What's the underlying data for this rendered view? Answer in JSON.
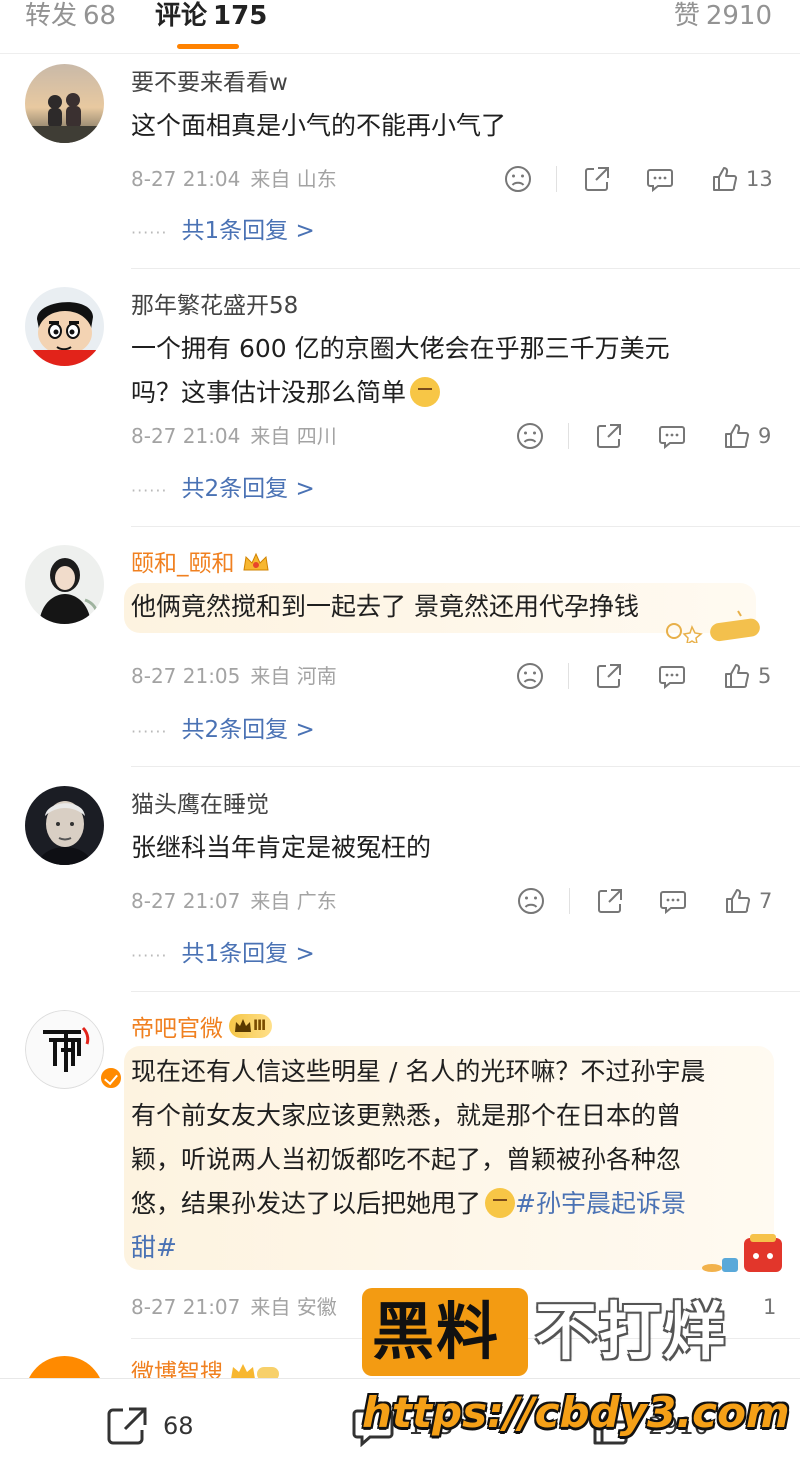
{
  "tabs": {
    "repost": {
      "label": "转发",
      "count": "68"
    },
    "comment": {
      "label": "评论",
      "count": "175"
    },
    "like": {
      "label": "赞",
      "count": "2910"
    }
  },
  "colors": {
    "accent": "#ff8200",
    "link": "#4a72b4",
    "badge_name": "#f08020"
  },
  "comments": [
    {
      "username": "要不要来看看w",
      "text": [
        "这个面相真是小气的不能再小气了"
      ],
      "date": "8-27 21:04",
      "from": "来自 山东",
      "likes": "13",
      "replies": "共1条回复 >"
    },
    {
      "username": "那年繁花盛开58",
      "text": [
        "一个拥有 600 亿的京圈大佬会在乎那三千万美元",
        "吗？这事估计没那么简单"
      ],
      "date": "8-27 21:04",
      "from": "来自 四川",
      "likes": "9",
      "replies": "共2条回复 >"
    },
    {
      "username": "颐和_颐和",
      "text": [
        "他俩竟然搅和到一起去了 景竟然还用代孕挣钱"
      ],
      "date": "8-27 21:05",
      "from": "来自 河南",
      "likes": "5",
      "replies": "共2条回复 >"
    },
    {
      "username": "猫头鹰在睡觉",
      "text": [
        "张继科当年肯定是被冤枉的"
      ],
      "date": "8-27 21:07",
      "from": "来自 广东",
      "likes": "7",
      "replies": "共1条回复 >"
    },
    {
      "username": "帝吧官微",
      "vip_level": "Ⅲ",
      "text": [
        "现在还有人信这些明星 / 名人的光环嘛？不过孙宇晨",
        "有个前女友大家应该更熟悉，就是那个在日本的曾",
        "颖，听说两人当初饭都吃不起了，曾颖被孙各种忽",
        "悠，结果孙发达了以后把她甩了"
      ],
      "hashtag_line1": "#孙宇晨起诉景",
      "hashtag_line2": "甜#",
      "date": "8-27 21:07",
      "from": "来自 安徽",
      "likes": "1"
    },
    {
      "username": "微博智搜"
    }
  ],
  "bottom_bar": {
    "repost_count": "68",
    "comment_count": "175",
    "like_count": "2910"
  },
  "watermark": {
    "brand_left": "黑料",
    "brand_right": "不打烊",
    "url": "https://cbdy3.com"
  },
  "icons": [
    "dislike-icon",
    "share-icon",
    "comment-icon",
    "thumb-up-icon",
    "repost-icon"
  ]
}
